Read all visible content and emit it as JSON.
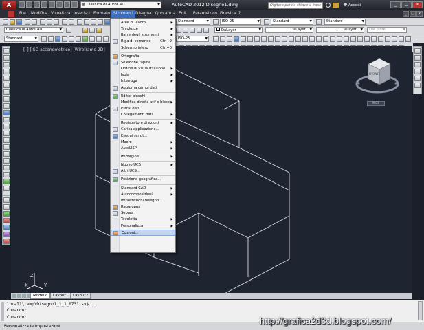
{
  "titlebar": {
    "workspace": "Classica di AutoCAD",
    "title": "AutoCAD 2012   Disegno1.dwg",
    "search_placeholder": "Digitare parola chiave o frase",
    "login": "Accedi"
  },
  "menubar": [
    "File",
    "Modifica",
    "Visualizza",
    "Inserisci",
    "Formato",
    "Strumenti",
    "Disegna",
    "Quotatura",
    "Edit",
    "Parametrico",
    "Finestra",
    "?"
  ],
  "menubar_active": "Strumenti",
  "toolbar": {
    "workspace_combo": "Classica di AutoCAD",
    "text_style": "Standard",
    "dim_style": "ISO-25",
    "table_style": "Standard",
    "mleader_style": "Standard",
    "layer_color": "DaLayer",
    "linetype": "DaLayer",
    "lineweight": "DaLayer",
    "plotstyle": "DaColore",
    "combo_left": "Standard",
    "combo_iso": "ISO-25"
  },
  "viewport_label": "[–] [ISO assonometrico] [Wireframe 2D]",
  "navcube": {
    "face": "FRONTE",
    "wcs": "WCS"
  },
  "ucs": {
    "x": "X",
    "y": "Y",
    "z": "Z"
  },
  "tabs": [
    "Modello",
    "Layout1",
    "Layout2"
  ],
  "command": {
    "line1": "local1\\temp\\Disegno1_1_1_0731.sv$...",
    "line2": "Comando:",
    "line3": "Comando:"
  },
  "status_text": "Personalizza le impostazioni",
  "watermark": "http://grafica2d3d.blogspot.com/",
  "dropdown": [
    {
      "label": "Aree di lavoro",
      "sub": true
    },
    {
      "label": "Tavolozze",
      "sub": true
    },
    {
      "label": "Barre degli strumenti",
      "sub": true
    },
    {
      "label": "Riga di comando",
      "shortcut": "Ctrl+9",
      "icon": true
    },
    {
      "label": "Schermo intero",
      "shortcut": "Ctrl+0"
    },
    {
      "sep": true
    },
    {
      "label": "Ortografia",
      "icon": true
    },
    {
      "label": "Selezione rapida...",
      "icon": true
    },
    {
      "label": "Ordine di visualizzazione",
      "sub": true
    },
    {
      "label": "Isola",
      "sub": true
    },
    {
      "label": "Interroga",
      "sub": true
    },
    {
      "label": "Aggiorna campi dati",
      "icon": true
    },
    {
      "sep": true
    },
    {
      "label": "Editor blocchi",
      "icon": true
    },
    {
      "label": "Modifica diretta xrif e blocco",
      "sub": true
    },
    {
      "label": "Estrai dati...",
      "icon": true
    },
    {
      "label": "Collegamenti dati",
      "sub": true
    },
    {
      "sep": true
    },
    {
      "label": "Registratore di azioni",
      "sub": true
    },
    {
      "label": "Carica applicazione...",
      "icon": true
    },
    {
      "label": "Esegui script...",
      "icon": true
    },
    {
      "label": "Macro",
      "sub": true
    },
    {
      "label": "AutoLISP",
      "sub": true
    },
    {
      "sep": true
    },
    {
      "label": "Immagine",
      "sub": true
    },
    {
      "sep": true
    },
    {
      "label": "Nuovo UCS",
      "sub": true
    },
    {
      "label": "Altri UCS...",
      "icon": true
    },
    {
      "sep": true
    },
    {
      "label": "Posizione geografica...",
      "icon": true
    },
    {
      "sep": true
    },
    {
      "label": "Standard CAD",
      "sub": true
    },
    {
      "label": "Autocomposizioni",
      "sub": true
    },
    {
      "label": "Impostazioni disegno..."
    },
    {
      "label": "Raggruppa",
      "icon": true
    },
    {
      "label": "Separa",
      "icon": true
    },
    {
      "label": "Tavoletta",
      "sub": true
    },
    {
      "label": "Personalizza",
      "sub": true
    },
    {
      "label": "Opzioni...",
      "icon": true,
      "highlight": true
    }
  ]
}
